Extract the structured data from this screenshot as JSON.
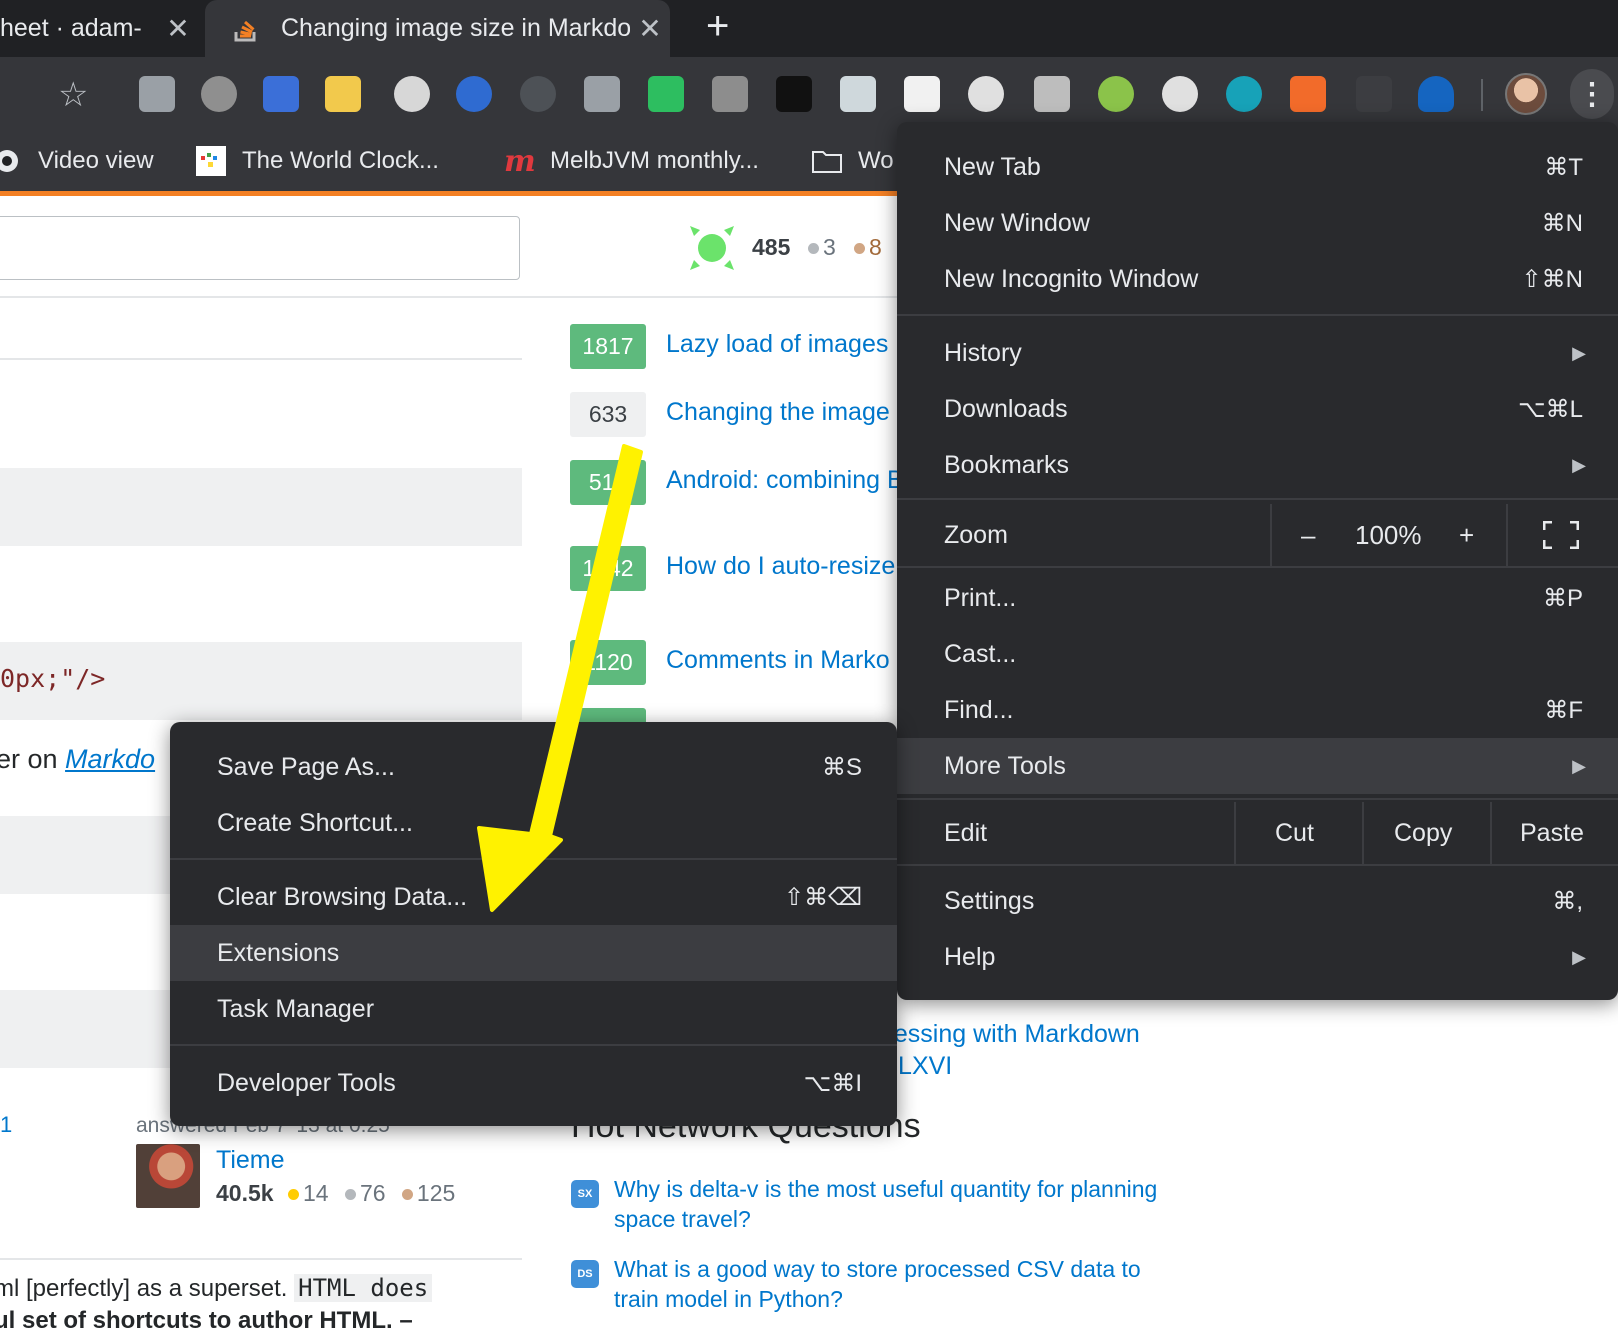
{
  "tabs": [
    {
      "title": "heet · adam-",
      "close": "✕"
    },
    {
      "title": "Changing image size in Markdo",
      "close": "✕"
    }
  ],
  "new_tab_label": "+",
  "bookmarks": [
    {
      "label": "Video view"
    },
    {
      "label": "The World Clock..."
    },
    {
      "label": "MelbJVM monthly..."
    },
    {
      "label": "Wo"
    }
  ],
  "page": {
    "reputation": "485",
    "silver_badges": "3",
    "bronze_badges": "8",
    "code_snippet": "0px;\"/>",
    "answer_prefix": "er on ",
    "answer_link": "Markdo",
    "related": [
      {
        "score": "1817",
        "title": "Lazy load of images",
        "accepted": true
      },
      {
        "score": "633",
        "title": "Changing the image",
        "accepted": false
      },
      {
        "score": "512",
        "title": "Android: combining Button or ImageButt",
        "accepted": true
      },
      {
        "score": "1242",
        "title": "How do I auto-resize container",
        "accepted": true
      },
      {
        "score": "1120",
        "title": "Comments in Marko",
        "accepted": true
      }
    ],
    "related_tail": [
      "nessing with Markdown",
      "CLXVI"
    ],
    "hot_network_title": "Hot Network Questions",
    "hot_questions": [
      {
        "site": "SX",
        "title": "Why is delta-v is the most useful quantity for planning space travel?"
      },
      {
        "site": "DS",
        "title": "What is a good way to store processed CSV data to train model in Python?"
      }
    ],
    "left_number": "1",
    "answered": "answered Feb 7 '13 at 0:25",
    "user": {
      "name": "Tieme",
      "rep": "40.5k",
      "gold": "14",
      "silver": "76",
      "bronze": "125"
    },
    "comment_part1": "ml [perfectly] as a superset. ",
    "comment_code": "HTML does",
    "comment_part2": "ul set of shortcuts to author HTML. –"
  },
  "main_menu": {
    "new_tab": {
      "label": "New Tab",
      "shortcut": "⌘T"
    },
    "new_window": {
      "label": "New Window",
      "shortcut": "⌘N"
    },
    "incognito": {
      "label": "New Incognito Window",
      "shortcut": "⇧⌘N"
    },
    "history": {
      "label": "History"
    },
    "downloads": {
      "label": "Downloads",
      "shortcut": "⌥⌘L"
    },
    "bookmarks": {
      "label": "Bookmarks"
    },
    "zoom": {
      "label": "Zoom",
      "minus": "–",
      "level": "100%",
      "plus": "+"
    },
    "print": {
      "label": "Print...",
      "shortcut": "⌘P"
    },
    "cast": {
      "label": "Cast..."
    },
    "find": {
      "label": "Find...",
      "shortcut": "⌘F"
    },
    "more_tools": {
      "label": "More Tools"
    },
    "edit": {
      "label": "Edit",
      "cut": "Cut",
      "copy": "Copy",
      "paste": "Paste"
    },
    "settings": {
      "label": "Settings",
      "shortcut": "⌘,"
    },
    "help": {
      "label": "Help"
    }
  },
  "sub_menu": {
    "save_page": {
      "label": "Save Page As...",
      "shortcut": "⌘S"
    },
    "create_shortcut": {
      "label": "Create Shortcut..."
    },
    "clear_data": {
      "label": "Clear Browsing Data...",
      "shortcut": "⇧⌘⌫"
    },
    "extensions": {
      "label": "Extensions"
    },
    "task_manager": {
      "label": "Task Manager"
    },
    "dev_tools": {
      "label": "Developer Tools",
      "shortcut": "⌥⌘I"
    }
  },
  "colors": {
    "accent_orange": "#f48024",
    "link_blue": "#0077cc",
    "menu_bg": "#292a2d",
    "highlight_arrow": "#fff200"
  }
}
